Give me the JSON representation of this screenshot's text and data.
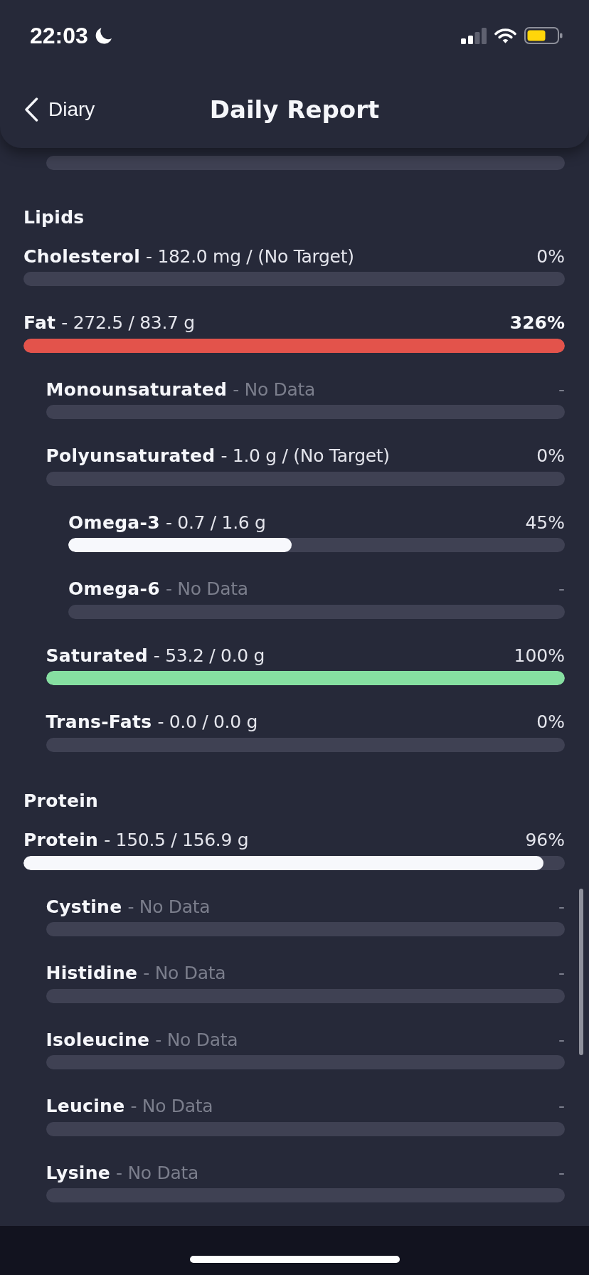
{
  "status_bar": {
    "time": "22:03"
  },
  "nav": {
    "back_label": "Diary",
    "title": "Daily Report"
  },
  "sections": [
    {
      "title": "Lipids",
      "rows": [
        {
          "name": "Cholesterol",
          "detail": "- 182.0 mg / (No Target)",
          "percent": "0%",
          "kind": "normal"
        },
        {
          "name": "Fat",
          "detail": "- 272.5 / 83.7 g",
          "percent": "326%",
          "kind": "over",
          "level": 1,
          "children": [
            {
              "name": "Monounsaturated",
              "detail": "- No Data",
              "percent": "-",
              "kind": "missing"
            },
            {
              "name": "Polyunsaturated",
              "detail": "- 1.0 g / (No Target)",
              "percent": "0%",
              "kind": "normal",
              "children": [
                {
                  "name": "Omega-3",
                  "detail": "- 0.7 / 1.6 g",
                  "percent": "45%",
                  "kind": "normal",
                  "level": 0.45
                },
                {
                  "name": "Omega-6",
                  "detail": "- No Data",
                  "percent": "-",
                  "kind": "missing"
                }
              ]
            },
            {
              "name": "Saturated",
              "detail": "- 53.2 / 0.0 g",
              "percent": "100%",
              "kind": "met",
              "level": 1
            },
            {
              "name": "Trans-Fats",
              "detail": "- 0.0 / 0.0 g",
              "percent": "0%",
              "kind": "normal"
            }
          ]
        }
      ]
    },
    {
      "title": "Protein",
      "rows": [
        {
          "name": "Protein",
          "detail": "- 150.5 / 156.9 g",
          "percent": "96%",
          "kind": "normal",
          "level": 0.96,
          "children": [
            {
              "name": "Cystine",
              "detail": "- No Data",
              "percent": "-",
              "kind": "missing"
            },
            {
              "name": "Histidine",
              "detail": "- No Data",
              "percent": "-",
              "kind": "missing"
            },
            {
              "name": "Isoleucine",
              "detail": "- No Data",
              "percent": "-",
              "kind": "missing"
            },
            {
              "name": "Leucine",
              "detail": "- No Data",
              "percent": "-",
              "kind": "missing"
            },
            {
              "name": "Lysine",
              "detail": "- No Data",
              "percent": "-",
              "kind": "missing"
            }
          ]
        }
      ]
    }
  ]
}
